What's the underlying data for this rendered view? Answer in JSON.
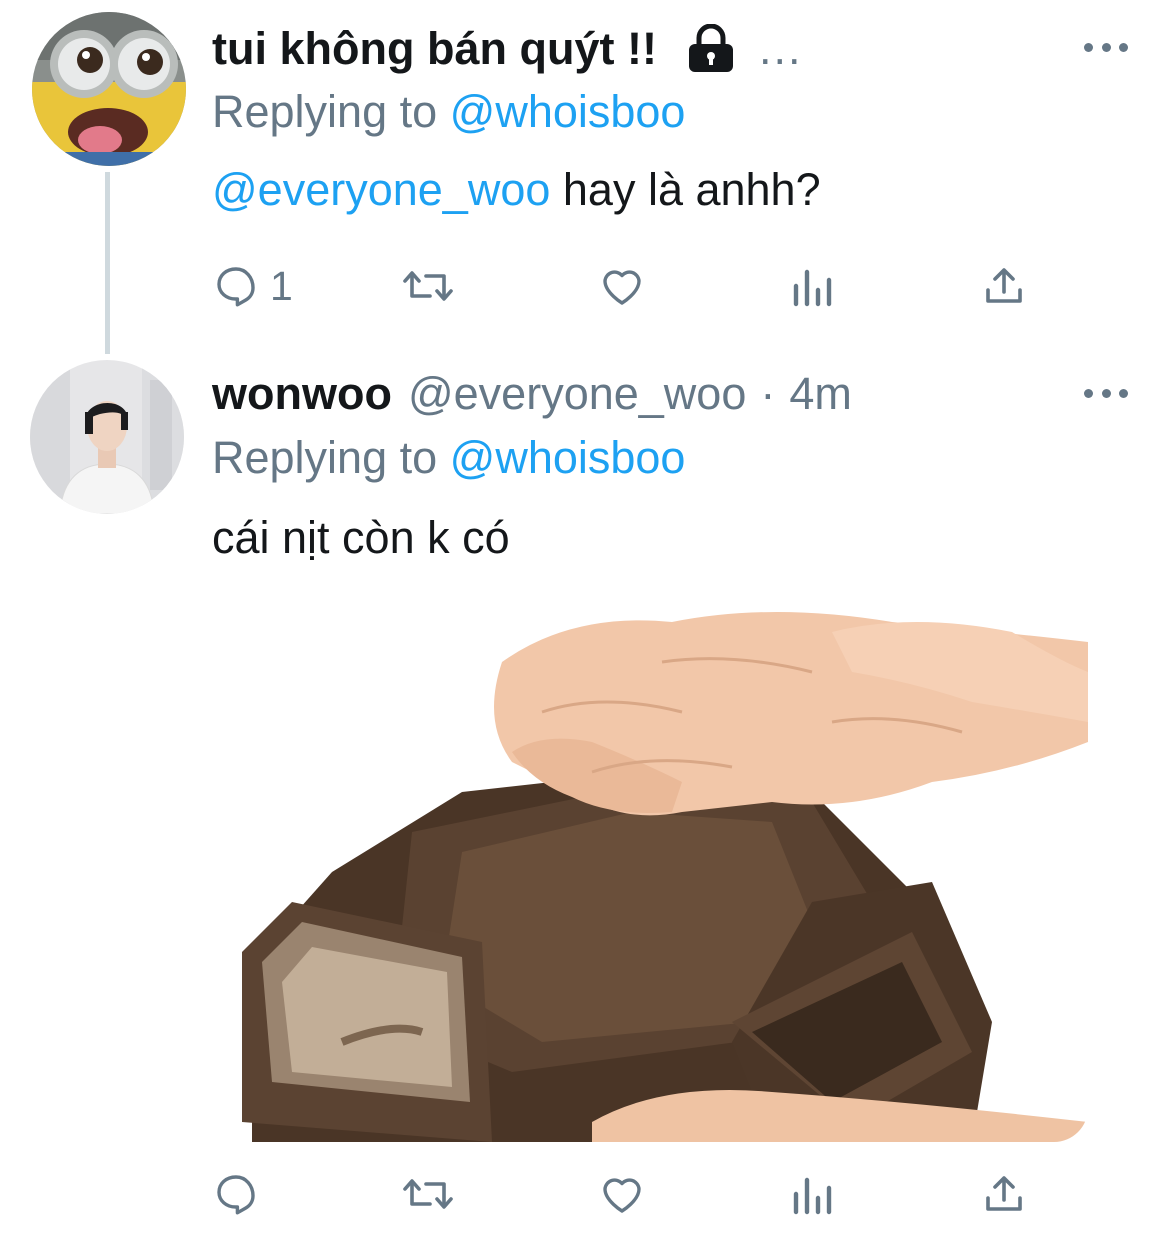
{
  "tweets": [
    {
      "name": "tui không bán quýt !!",
      "trailing": "...",
      "replying_prefix": "Replying to ",
      "replying_handle": "@whoisboo",
      "text_mention": "@everyone_woo",
      "text": " hay là anhh?",
      "actions": {
        "reply_count": "1"
      }
    },
    {
      "name": "wonwoo",
      "handle": "@everyone_woo",
      "separator": "·",
      "time": "4m",
      "replying_prefix": "Replying to ",
      "replying_handle": "@whoisboo",
      "text": "cái nịt còn k có"
    }
  ],
  "icons": {
    "lock": "lock-icon",
    "more": "more-icon",
    "reply": "reply-icon",
    "retweet": "retweet-icon",
    "like": "like-icon",
    "analytics": "analytics-icon",
    "share": "share-icon"
  },
  "colors": {
    "accent": "#1da1f2",
    "secondary_text": "#657786",
    "primary_text": "#14171a",
    "thread_line": "#cfd9de"
  }
}
